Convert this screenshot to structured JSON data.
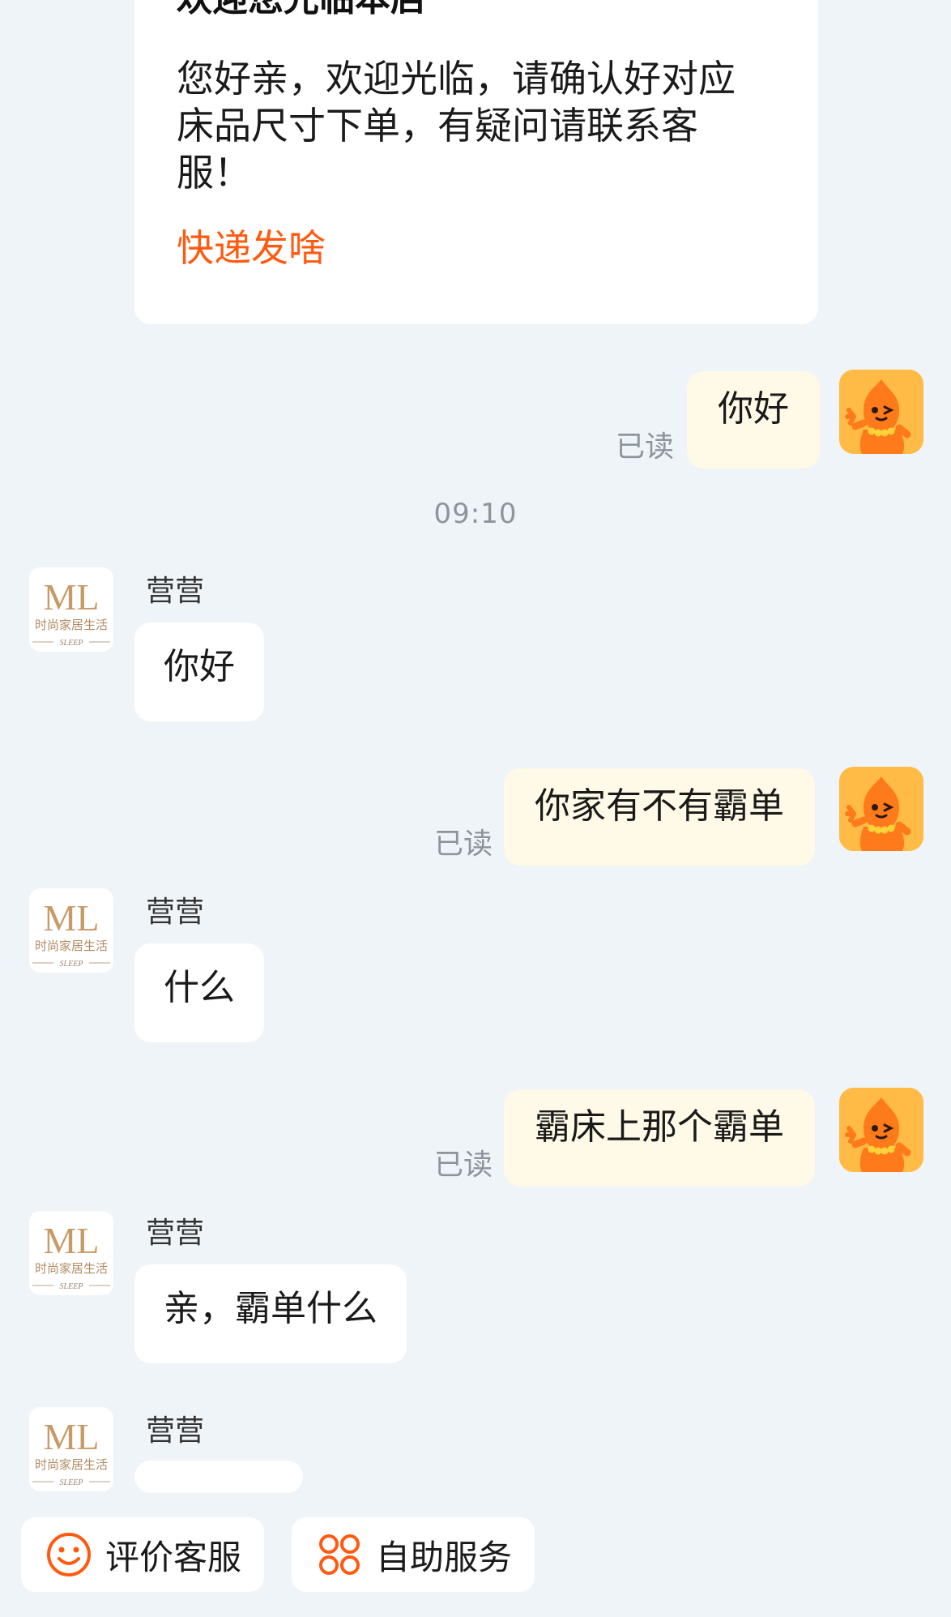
{
  "welcome_card": {
    "title": "欢迎您光临本店",
    "body": "您好亲，欢迎光临，请确认好对应床品尺寸下单，有疑问请联系客服！",
    "link": "快递发啥"
  },
  "timestamp": "09:10",
  "read_label": "已读",
  "shop": {
    "logo_text": "ML",
    "logo_subtitle": "时尚家居生活",
    "logo_tag": "SLEEP",
    "agent_name": "营营"
  },
  "messages": [
    {
      "from": "user",
      "text": "你好"
    },
    {
      "from": "shop",
      "text": "你好"
    },
    {
      "from": "user",
      "text": "你家有不有霸单"
    },
    {
      "from": "shop",
      "text": "什么"
    },
    {
      "from": "user",
      "text": "霸床上那个霸单"
    },
    {
      "from": "shop",
      "text": "亲，霸单什么"
    },
    {
      "from": "shop",
      "text": ""
    }
  ],
  "bottom_bar": {
    "rate_label": "评价客服",
    "rate_icon": "smile-icon",
    "self_service_label": "自助服务",
    "self_service_icon": "grid-icon"
  },
  "colors": {
    "background": "#eff4f8",
    "accent": "#ff5a0f",
    "user_bubble": "#fff9e7",
    "shop_bubble": "#ffffff"
  }
}
